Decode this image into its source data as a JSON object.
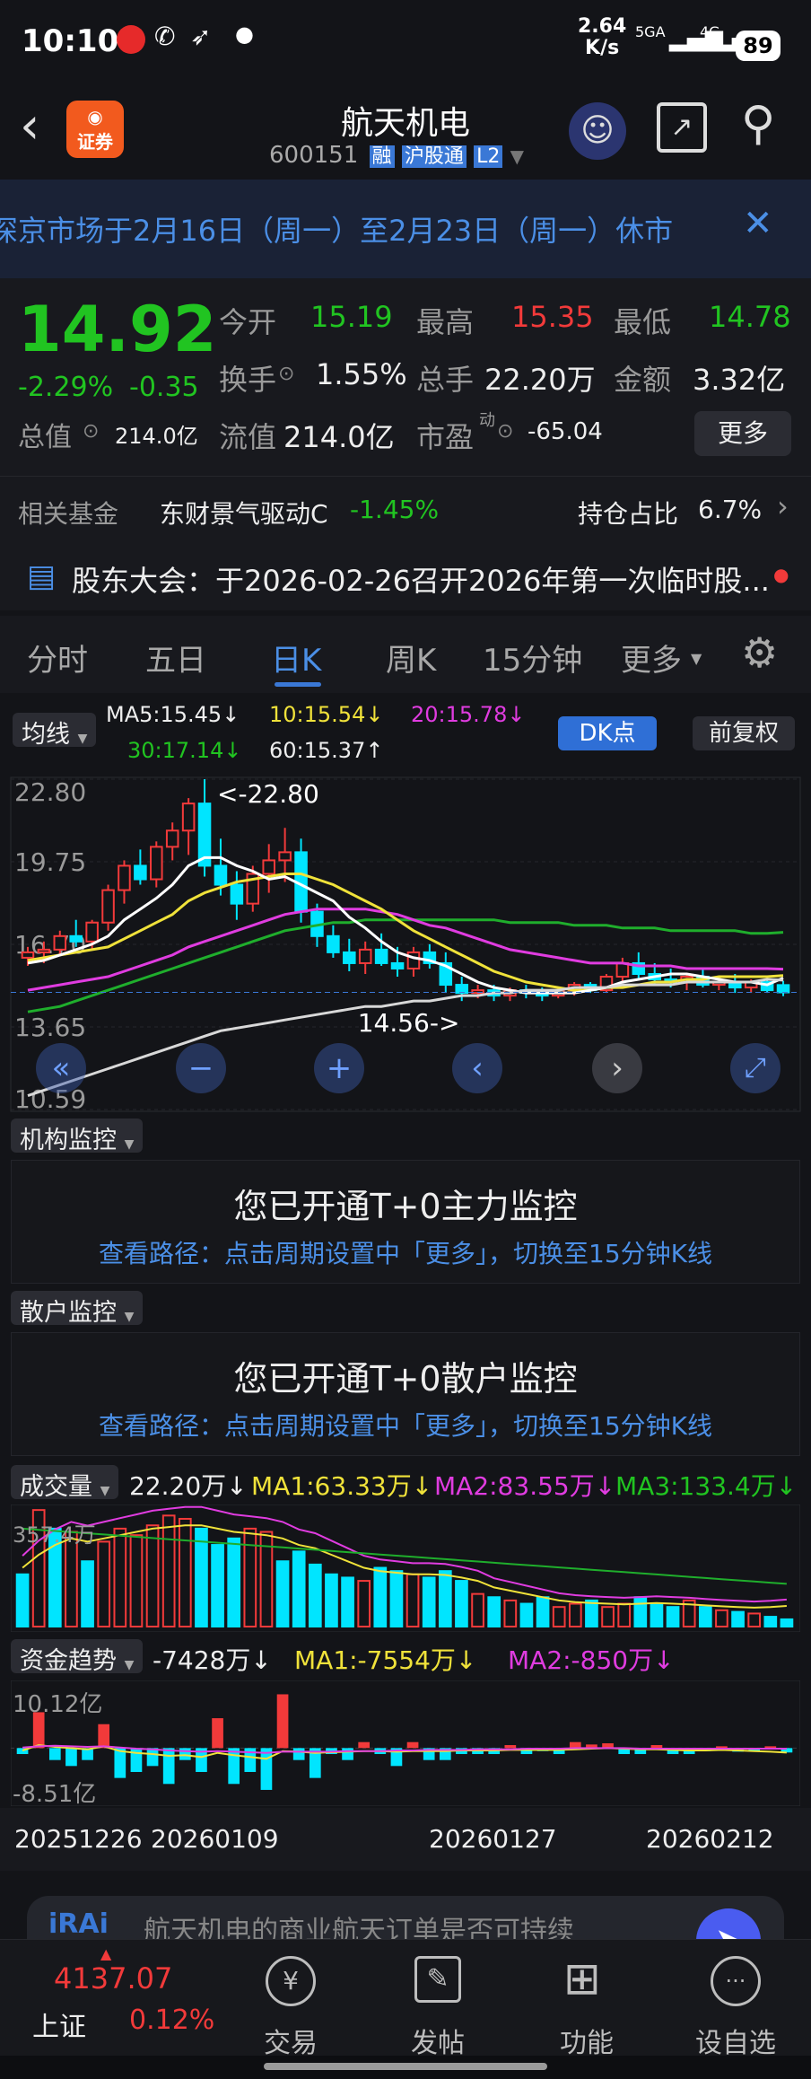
{
  "status": {
    "time": "10:10",
    "net_speed_value": "2.64",
    "net_speed_unit": "K/s",
    "sig1": "5GA",
    "sig2": "4G",
    "battery": "89"
  },
  "header": {
    "title": "航天机电",
    "code": "600151",
    "badges": [
      "融",
      "沪股通",
      "L2"
    ],
    "logo_text": "证券"
  },
  "marquee": {
    "text": "深京市场于2月16日（周一）至2月23日（周一）休市"
  },
  "quote": {
    "price": "14.92",
    "pct": "-2.29%",
    "chg": "-0.35",
    "open_label": "今开",
    "open": "15.19",
    "high_label": "最高",
    "high": "15.35",
    "low_label": "最低",
    "low": "14.78",
    "turnover_label": "换手",
    "turnover": "1.55%",
    "volume_label": "总手",
    "volume": "22.20万",
    "amount_label": "金额",
    "amount": "3.32亿",
    "mcap_label": "总值",
    "mcap": "214.0亿",
    "float_label": "流值",
    "float": "214.0亿",
    "pe_label": "市盈",
    "pe_sup": "动",
    "pe": "-65.04",
    "more_button": "更多"
  },
  "fund": {
    "label": "相关基金",
    "name": "东财景气驱动C",
    "pct": "-1.45%",
    "hold_label": "持仓占比",
    "hold": "6.7%"
  },
  "notice": {
    "text": "股东大会：于2026-02-26召开2026年第一次临时股..."
  },
  "tabs": [
    {
      "label": "分时"
    },
    {
      "label": "五日"
    },
    {
      "label": "日K"
    },
    {
      "label": "周K"
    },
    {
      "label": "15分钟"
    },
    {
      "label": "更多"
    }
  ],
  "kline": {
    "ma_selector": "均线",
    "ma5": "MA5:15.45↓",
    "ma10": "10:15.54↓",
    "ma20": "20:15.78↓",
    "ma30": "30:17.14↓",
    "ma60": "60:15.37↑",
    "dk_button": "DK点",
    "adjust_button": "前复权",
    "y_ticks": [
      "22.80",
      "19.75",
      "16.70",
      "13.65",
      "10.59"
    ],
    "high_label": "<-22.80",
    "low_label": "14.56->"
  },
  "inst_monitor": {
    "dropdown": "机构监控",
    "title": "您已开通T+0主力监控",
    "hint": "查看路径：点击周期设置中「更多」，切换至15分钟K线"
  },
  "retail_monitor": {
    "dropdown": "散户监控",
    "title": "您已开通T+0散户监控",
    "hint": "查看路径：点击周期设置中「更多」，切换至15分钟K线"
  },
  "volume": {
    "dropdown": "成交量",
    "value": "22.20万↓",
    "ma1": "MA1:63.33万↓",
    "ma2": "MA2:83.55万↓",
    "ma3": "MA3:133.4万↓",
    "max_label": "357.4万"
  },
  "fund_trend": {
    "dropdown": "资金趋势",
    "value": "-7428万↓",
    "ma1": "MA1:-7554万↓",
    "ma2": "MA2:-850万↓",
    "top_label": "10.12亿",
    "bottom_label": "-8.51亿"
  },
  "dates": [
    "20251226",
    "20260109",
    "20260127",
    "20260212"
  ],
  "ad": {
    "brand": "iRAi",
    "text": "航天机电的商业航天订单是否可持续"
  },
  "bottom_nav": {
    "index_value": "4137.07",
    "index_name": "上证",
    "index_pct": "0.12%",
    "items": [
      {
        "label": "交易"
      },
      {
        "label": "发帖"
      },
      {
        "label": "功能"
      },
      {
        "label": "设自选"
      }
    ]
  },
  "colors": {
    "up": "#f23a3a",
    "down": "#00e5ff",
    "accent": "#3a78d6"
  },
  "chart_data": [
    {
      "type": "candlestick",
      "ylim": [
        10.59,
        22.8
      ],
      "ohlc": [
        [
          16.2,
          16.6,
          15.9,
          16.4
        ],
        [
          16.4,
          16.8,
          16.0,
          16.5
        ],
        [
          16.5,
          17.2,
          16.3,
          17.0
        ],
        [
          17.0,
          17.6,
          16.6,
          16.8
        ],
        [
          16.8,
          17.6,
          16.5,
          17.5
        ],
        [
          17.5,
          18.9,
          17.2,
          18.7
        ],
        [
          18.7,
          19.8,
          18.2,
          19.6
        ],
        [
          19.6,
          20.2,
          18.9,
          19.1
        ],
        [
          19.1,
          20.5,
          18.8,
          20.3
        ],
        [
          20.3,
          21.2,
          19.8,
          20.9
        ],
        [
          20.9,
          22.1,
          20.0,
          21.9
        ],
        [
          21.9,
          22.8,
          19.2,
          19.6
        ],
        [
          19.6,
          20.6,
          18.5,
          18.9
        ],
        [
          18.9,
          19.4,
          17.6,
          18.2
        ],
        [
          18.2,
          19.6,
          17.9,
          19.3
        ],
        [
          19.3,
          20.4,
          18.6,
          19.8
        ],
        [
          19.8,
          21.0,
          19.0,
          20.1
        ],
        [
          20.1,
          20.6,
          17.5,
          17.9
        ],
        [
          17.9,
          18.2,
          16.6,
          17.0
        ],
        [
          17.0,
          17.4,
          16.2,
          16.4
        ],
        [
          16.4,
          16.9,
          15.7,
          16.0
        ],
        [
          16.0,
          16.8,
          15.6,
          16.5
        ],
        [
          16.5,
          17.1,
          15.9,
          16.0
        ],
        [
          16.0,
          16.6,
          15.5,
          15.8
        ],
        [
          15.8,
          16.6,
          15.5,
          16.4
        ],
        [
          16.4,
          16.7,
          15.8,
          16.0
        ],
        [
          16.0,
          16.4,
          14.9,
          15.2
        ],
        [
          15.2,
          15.5,
          14.6,
          14.9
        ],
        [
          14.9,
          15.2,
          14.7,
          15.0
        ],
        [
          15.0,
          15.2,
          14.6,
          14.8
        ],
        [
          14.8,
          15.1,
          14.6,
          15.0
        ],
        [
          15.0,
          15.2,
          14.7,
          14.9
        ],
        [
          14.9,
          15.1,
          14.6,
          14.8
        ],
        [
          14.8,
          15.1,
          14.7,
          15.0
        ],
        [
          15.0,
          15.3,
          14.8,
          15.2
        ],
        [
          15.2,
          15.3,
          14.9,
          15.0
        ],
        [
          15.0,
          15.6,
          14.9,
          15.5
        ],
        [
          15.5,
          16.2,
          15.3,
          16.0
        ],
        [
          16.0,
          16.4,
          15.4,
          15.6
        ],
        [
          15.6,
          16.0,
          15.2,
          15.4
        ],
        [
          15.4,
          15.8,
          15.1,
          15.3
        ],
        [
          15.3,
          15.6,
          15.0,
          15.5
        ],
        [
          15.5,
          15.8,
          15.1,
          15.2
        ],
        [
          15.2,
          15.5,
          15.0,
          15.3
        ],
        [
          15.3,
          15.6,
          14.9,
          15.1
        ],
        [
          15.1,
          15.4,
          14.9,
          15.3
        ],
        [
          15.3,
          15.4,
          14.9,
          15.0
        ],
        [
          15.19,
          15.35,
          14.78,
          14.92
        ]
      ],
      "ma5": [
        16.0,
        16.1,
        16.3,
        16.5,
        16.7,
        17.0,
        17.6,
        18.0,
        18.4,
        18.9,
        19.6,
        19.9,
        19.9,
        19.6,
        19.4,
        19.1,
        19.2,
        18.9,
        18.6,
        18.3,
        17.7,
        17.3,
        16.8,
        16.4,
        16.2,
        16.1,
        15.9,
        15.6,
        15.3,
        15.1,
        15.0,
        14.9,
        14.9,
        14.9,
        14.9,
        15.0,
        15.1,
        15.3,
        15.4,
        15.5,
        15.6,
        15.6,
        15.5,
        15.4,
        15.3,
        15.3,
        15.2,
        15.45
      ],
      "ma10": [
        16.1,
        16.2,
        16.3,
        16.4,
        16.5,
        16.6,
        16.9,
        17.2,
        17.5,
        17.8,
        18.3,
        18.6,
        18.8,
        19.0,
        19.1,
        19.2,
        19.3,
        19.3,
        19.1,
        18.9,
        18.6,
        18.3,
        18.0,
        17.6,
        17.2,
        16.9,
        16.6,
        16.3,
        16.0,
        15.7,
        15.5,
        15.3,
        15.2,
        15.1,
        15.0,
        15.0,
        15.1,
        15.1,
        15.2,
        15.3,
        15.3,
        15.4,
        15.4,
        15.5,
        15.5,
        15.5,
        15.5,
        15.54
      ],
      "ma20": [
        15.0,
        15.1,
        15.2,
        15.3,
        15.4,
        15.5,
        15.7,
        15.9,
        16.1,
        16.3,
        16.6,
        16.8,
        17.0,
        17.2,
        17.4,
        17.6,
        17.8,
        17.9,
        18.0,
        18.0,
        18.0,
        18.0,
        17.9,
        17.8,
        17.6,
        17.4,
        17.3,
        17.1,
        16.9,
        16.7,
        16.5,
        16.4,
        16.3,
        16.2,
        16.1,
        16.0,
        16.0,
        16.0,
        15.9,
        15.9,
        15.9,
        15.8,
        15.8,
        15.8,
        15.8,
        15.8,
        15.8,
        15.78
      ],
      "ma30": [
        14.2,
        14.3,
        14.4,
        14.6,
        14.8,
        15.0,
        15.2,
        15.4,
        15.6,
        15.8,
        16.0,
        16.2,
        16.4,
        16.6,
        16.8,
        17.0,
        17.2,
        17.3,
        17.4,
        17.5,
        17.5,
        17.6,
        17.6,
        17.6,
        17.6,
        17.6,
        17.6,
        17.6,
        17.6,
        17.6,
        17.5,
        17.5,
        17.5,
        17.5,
        17.4,
        17.4,
        17.4,
        17.3,
        17.3,
        17.3,
        17.2,
        17.2,
        17.2,
        17.2,
        17.2,
        17.1,
        17.1,
        17.14
      ],
      "ma60": [
        11.1,
        11.3,
        11.5,
        11.7,
        11.9,
        12.1,
        12.3,
        12.5,
        12.7,
        12.9,
        13.1,
        13.3,
        13.5,
        13.6,
        13.7,
        13.8,
        13.9,
        14.0,
        14.1,
        14.2,
        14.3,
        14.4,
        14.4,
        14.5,
        14.6,
        14.6,
        14.7,
        14.8,
        14.8,
        14.9,
        14.9,
        15.0,
        15.0,
        15.0,
        15.1,
        15.1,
        15.1,
        15.2,
        15.2,
        15.2,
        15.2,
        15.3,
        15.3,
        15.3,
        15.3,
        15.3,
        15.4,
        15.37
      ]
    },
    {
      "type": "bar",
      "name": "成交量",
      "ylim": [
        0,
        357.4
      ],
      "values": [
        160,
        357,
        300,
        290,
        200,
        260,
        300,
        280,
        310,
        340,
        330,
        300,
        250,
        270,
        300,
        290,
        200,
        230,
        190,
        160,
        150,
        140,
        180,
        170,
        160,
        150,
        170,
        140,
        100,
        90,
        80,
        70,
        90,
        60,
        70,
        80,
        60,
        70,
        90,
        70,
        60,
        80,
        60,
        50,
        45,
        40,
        30,
        22.2
      ],
      "colors": [
        "d",
        "u",
        "d",
        "u",
        "d",
        "u",
        "u",
        "u",
        "u",
        "u",
        "u",
        "d",
        "d",
        "d",
        "u",
        "u",
        "d",
        "d",
        "d",
        "d",
        "d",
        "u",
        "d",
        "d",
        "u",
        "d",
        "d",
        "d",
        "u",
        "d",
        "u",
        "d",
        "d",
        "u",
        "u",
        "d",
        "u",
        "u",
        "d",
        "d",
        "d",
        "u",
        "d",
        "u",
        "d",
        "u",
        "d",
        "d"
      ],
      "ma1": [
        180,
        220,
        250,
        270,
        260,
        270,
        280,
        290,
        300,
        305,
        310,
        310,
        300,
        290,
        285,
        280,
        270,
        250,
        240,
        220,
        200,
        180,
        170,
        165,
        160,
        160,
        158,
        150,
        140,
        120,
        110,
        100,
        90,
        80,
        75,
        72,
        70,
        68,
        70,
        72,
        70,
        68,
        65,
        62,
        60,
        58,
        60,
        63.33
      ]
    },
    {
      "type": "bar",
      "name": "资金趋势",
      "ylim": [
        -8.51,
        10.12
      ],
      "values": [
        -1,
        6,
        -2,
        -3,
        -2,
        4,
        -5,
        -4,
        -3,
        -6,
        -2,
        -4,
        5,
        -6,
        -4,
        -7,
        9,
        -2,
        -5,
        -1,
        -2,
        1,
        -1,
        -3,
        1,
        -2,
        -2,
        -1,
        -1,
        -1,
        0.5,
        -1,
        -0.5,
        -1,
        1,
        0.6,
        0.8,
        -1,
        -1,
        0.5,
        -1,
        -1,
        -0.5,
        0.3,
        -0.6,
        -0.6,
        0.3,
        -0.74
      ],
      "ma1": [
        -0.4,
        0.5,
        0.2,
        0,
        -0.2,
        0.3,
        -0.5,
        -0.8,
        -1,
        -1.3,
        -1.2,
        -1.5,
        -0.8,
        -1.2,
        -1.5,
        -1.8,
        -0.5,
        -0.6,
        -0.8,
        -0.7,
        -0.6,
        -0.5,
        -0.5,
        -0.6,
        -0.5,
        -0.5,
        -0.5,
        -0.4,
        -0.4,
        -0.4,
        -0.3,
        -0.3,
        -0.3,
        -0.3,
        -0.2,
        -0.1,
        0,
        -0.1,
        -0.2,
        -0.2,
        -0.3,
        -0.4,
        -0.4,
        -0.3,
        -0.4,
        -0.5,
        -0.6,
        -0.76
      ],
      "ma2": [
        0.1,
        0.3,
        0.4,
        0.3,
        0.2,
        0.3,
        0.1,
        -0.1,
        -0.2,
        -0.4,
        -0.5,
        -0.6,
        -0.5,
        -0.6,
        -0.7,
        -0.8,
        -0.6,
        -0.6,
        -0.6,
        -0.6,
        -0.5,
        -0.5,
        -0.5,
        -0.4,
        -0.4,
        -0.3,
        -0.3,
        -0.3,
        -0.2,
        -0.2,
        -0.2,
        -0.1,
        -0.1,
        -0.1,
        0,
        0,
        0,
        0,
        -0.1,
        -0.1,
        -0.1,
        -0.1,
        -0.1,
        -0.1,
        -0.1,
        -0.1,
        -0.1,
        -0.09
      ]
    }
  ]
}
